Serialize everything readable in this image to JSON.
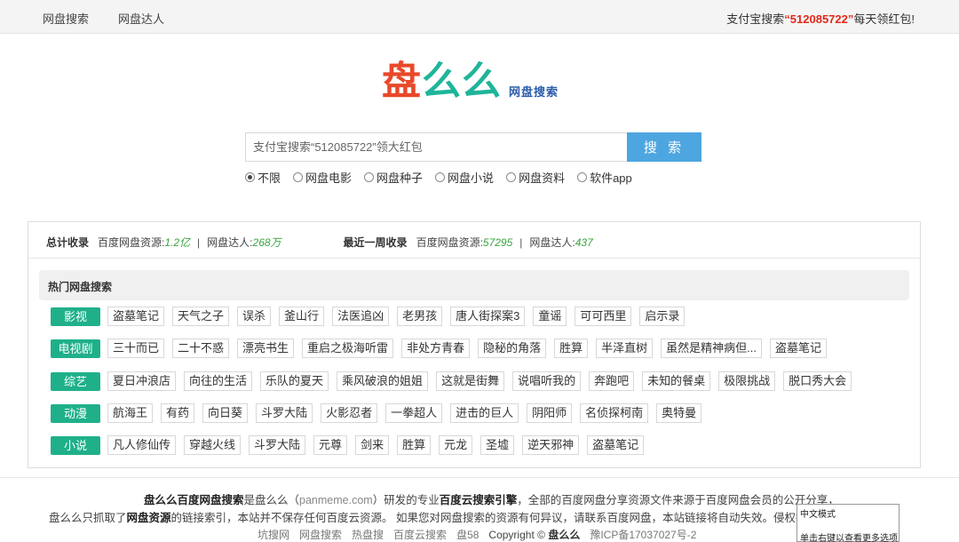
{
  "topbar": {
    "nav": [
      "网盘搜索",
      "网盘达人"
    ],
    "promo_prefix": "支付宝搜索",
    "promo_code": "“512085722”",
    "promo_suffix": "每天领红包!"
  },
  "logo": {
    "chars": [
      "盘",
      "么",
      "么"
    ],
    "sub": "网盘搜索",
    "colors": {
      "first": "#e8492a",
      "second": "#1fb59a"
    }
  },
  "search": {
    "placeholder": "支付宝搜索“512085722”领大红包",
    "button": "搜 索",
    "button_color": "#4ea6e0"
  },
  "filters": [
    {
      "label": "不限",
      "selected": true
    },
    {
      "label": "网盘电影",
      "selected": false
    },
    {
      "label": "网盘种子",
      "selected": false
    },
    {
      "label": "网盘小说",
      "selected": false
    },
    {
      "label": "网盘资料",
      "selected": false
    },
    {
      "label": "软件app",
      "selected": false
    }
  ],
  "stats": {
    "total_label": "总计收录",
    "total_res_label": "百度网盘资源:",
    "total_res": "1.2亿",
    "sep": "|",
    "total_users_label": "网盘达人:",
    "total_users": "268万",
    "week_label": "最近一周收录",
    "week_res_label": "百度网盘资源:",
    "week_res": "57295",
    "week_users_label": "网盘达人:",
    "week_users": "437"
  },
  "hot": {
    "title": "热门网盘搜索",
    "accent": "#1fb08a",
    "rows": [
      {
        "category": "影视",
        "tags": [
          "盗墓笔记",
          "天气之子",
          "误杀",
          "釜山行",
          "法医追凶",
          "老男孩",
          "唐人街探案3",
          "童谣",
          "可可西里",
          "启示录"
        ]
      },
      {
        "category": "电视剧",
        "tags": [
          "三十而已",
          "二十不惑",
          "漂亮书生",
          "重启之极海听雷",
          "非处方青春",
          "隐秘的角落",
          "胜算",
          "半泽直树",
          "虽然是精神病但...",
          "盗墓笔记"
        ]
      },
      {
        "category": "综艺",
        "tags": [
          "夏日冲浪店",
          "向往的生活",
          "乐队的夏天",
          "乘风破浪的姐姐",
          "这就是街舞",
          "说唱听我的",
          "奔跑吧",
          "未知的餐桌",
          "极限挑战",
          "脱口秀大会"
        ]
      },
      {
        "category": "动漫",
        "tags": [
          "航海王",
          "有药",
          "向日葵",
          "斗罗大陆",
          "火影忍者",
          "一拳超人",
          "进击的巨人",
          "阴阳师",
          "名侦探柯南",
          "奥特曼"
        ]
      },
      {
        "category": "小说",
        "tags": [
          "凡人修仙传",
          "穿越火线",
          "斗罗大陆",
          "元尊",
          "剑来",
          "胜算",
          "元龙",
          "圣墟",
          "逆天邪神",
          "盗墓笔记"
        ]
      }
    ]
  },
  "footer": {
    "l1_a": "盘么么百度网盘搜索",
    "l1_b": "是盘么么（",
    "l1_domain": "panmeme.com",
    "l1_c": "）研发的专业",
    "l1_d": "百度云搜索引擎",
    "l1_e": "，全部的百度网盘分享资源文件来源于百度网盘会员的公开分享，",
    "l2_a": "盘么么只抓取了",
    "l2_b": "网盘资源",
    "l2_c": "的链接索引，本站并不保存任何百度云资源。 如果您对网盘搜索的资源有何异议，请联系百度网盘，本站链接将自动失效。侵权投诉邮箱：",
    "links": [
      "坑搜网",
      "网盘搜索",
      "热盘搜",
      "百度云搜索",
      "盘58"
    ],
    "copyright_prefix": "Copyright ©",
    "copyright_name": "盘么么",
    "icp": "豫ICP备17037027号-2"
  },
  "ime": {
    "mode": "中文模式",
    "hint": "单击右键以查看更多选项"
  }
}
